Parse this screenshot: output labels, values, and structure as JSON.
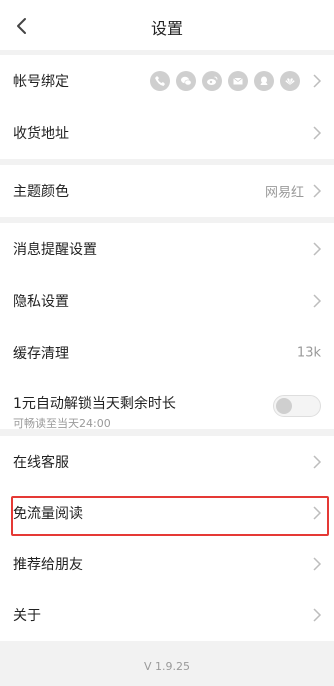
{
  "header": {
    "title": "设置",
    "back_icon": "chevron-left-icon"
  },
  "account": {
    "bind_label": "帐号绑定",
    "bind_icons": [
      "phone-icon",
      "wechat-icon",
      "weibo-icon",
      "email-icon",
      "qq-icon",
      "huawei-icon"
    ],
    "address_label": "收货地址"
  },
  "theme": {
    "label": "主题颜色",
    "value": "网易红"
  },
  "settings": {
    "notify_label": "消息提醒设置",
    "privacy_label": "隐私设置",
    "cache_label": "缓存清理",
    "cache_value": "13k",
    "autounlock_label": "1元自动解锁当天剩余时长",
    "autounlock_sub": "可畅读至当天24:00",
    "autounlock_on": false
  },
  "more": {
    "service_label": "在线客服",
    "free_read_label": "免流量阅读",
    "recommend_label": "推荐给朋友",
    "about_label": "关于"
  },
  "footer": {
    "version": "V 1.9.25"
  },
  "colors": {
    "highlight": "#e53935",
    "toggle_knob": "#cfcfcf",
    "muted": "#9a9a9a"
  }
}
